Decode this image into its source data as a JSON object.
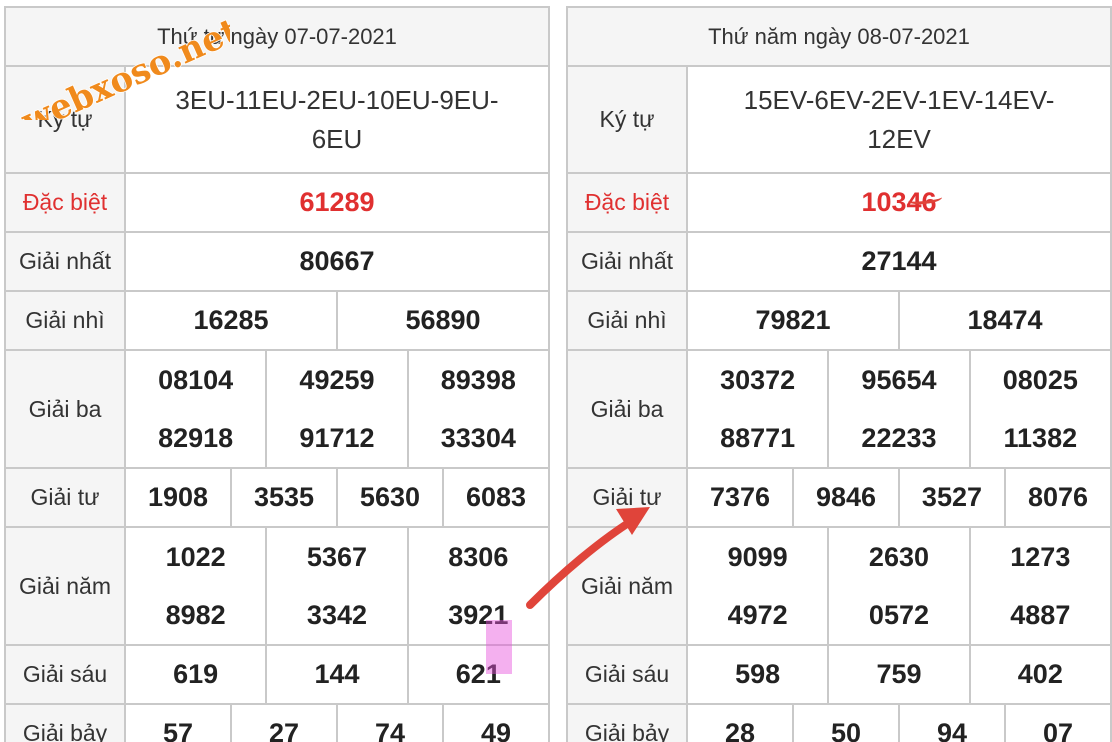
{
  "watermark": "webxoso.net",
  "left": {
    "header": "Thứ tư ngày 07-07-2021",
    "codes": "3EU-11EU-2EU-10EU-9EU-6EU",
    "labels": {
      "code": "Ký tự",
      "special": "Đặc biệt",
      "first": "Giải nhất",
      "second": "Giải nhì",
      "third": "Giải ba",
      "fourth": "Giải tư",
      "fifth": "Giải năm",
      "sixth": "Giải sáu",
      "seventh": "Giải bảy"
    },
    "special": "61289",
    "first": "80667",
    "second": [
      "16285",
      "56890"
    ],
    "third": [
      "08104",
      "49259",
      "89398",
      "82918",
      "91712",
      "33304"
    ],
    "fourth": [
      "1908",
      "3535",
      "5630",
      "6083"
    ],
    "fifth": [
      "1022",
      "5367",
      "8306",
      "8982",
      "3342",
      "3921"
    ],
    "sixth": [
      "619",
      "144",
      "621"
    ],
    "seventh": [
      "57",
      "27",
      "74",
      "49"
    ]
  },
  "right": {
    "header": "Thứ năm ngày 08-07-2021",
    "codes": "15EV-6EV-2EV-1EV-14EV-12EV",
    "labels": {
      "code": "Ký tự",
      "special": "Đặc biệt",
      "first": "Giải nhất",
      "second": "Giải nhì",
      "third": "Giải ba",
      "fourth": "Giải tư",
      "fifth": "Giải năm",
      "sixth": "Giải sáu",
      "seventh": "Giải bảy"
    },
    "special": "10346",
    "first": "27144",
    "second": [
      "79821",
      "18474"
    ],
    "third": [
      "30372",
      "95654",
      "08025",
      "88771",
      "22233",
      "11382"
    ],
    "fourth": [
      "7376",
      "9846",
      "3527",
      "8076"
    ],
    "fifth": [
      "9099",
      "2630",
      "1273",
      "4972",
      "0572",
      "4887"
    ],
    "sixth": [
      "598",
      "759",
      "402"
    ],
    "seventh": [
      "28",
      "50",
      "94",
      "07"
    ]
  },
  "colors": {
    "special": "#e03030",
    "annotation": "#e0443a",
    "highlight": "#e650dc",
    "watermark": "#f08a1c"
  }
}
